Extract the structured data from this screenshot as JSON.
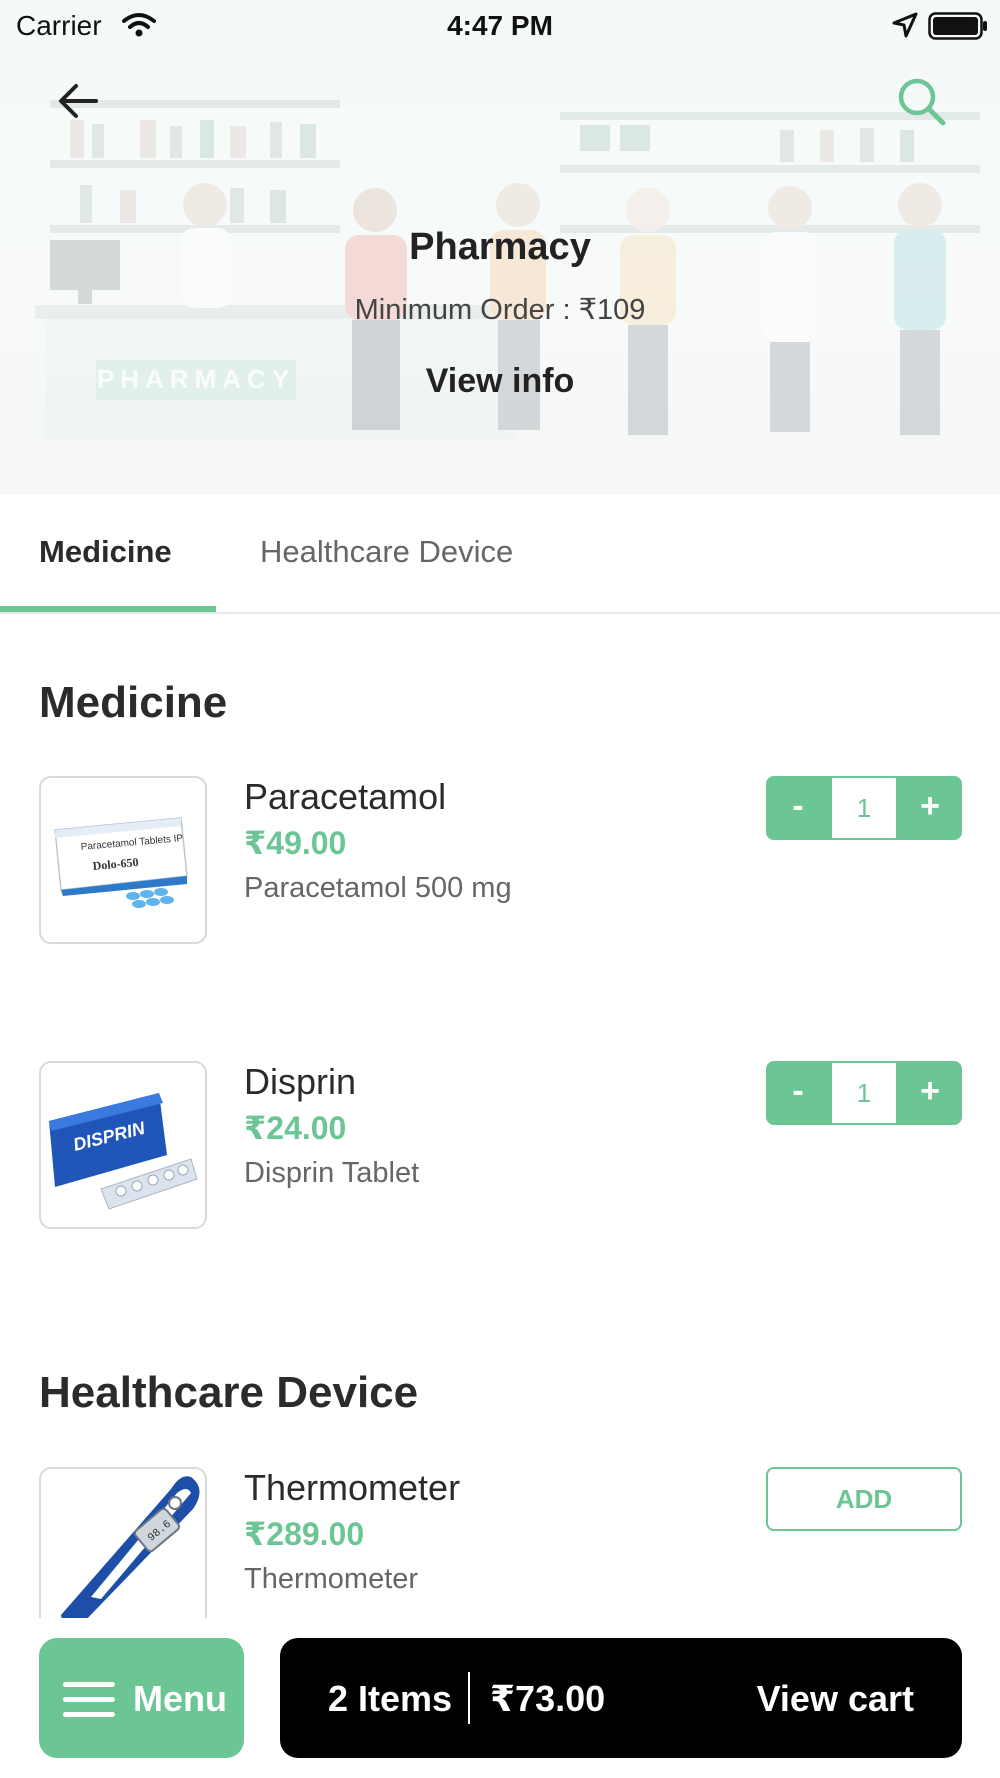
{
  "status_bar": {
    "carrier": "Carrier",
    "time": "4:47 PM"
  },
  "header": {
    "title": "Pharmacy",
    "minimum_order": "Minimum Order : ₹109",
    "view_info": "View info",
    "backdrop_sign": "PHARMACY"
  },
  "tabs": [
    {
      "label": "Medicine",
      "active": true
    },
    {
      "label": "Healthcare Device",
      "active": false
    }
  ],
  "sections": [
    {
      "heading": "Medicine",
      "products": [
        {
          "name": "Paracetamol",
          "price": "₹49.00",
          "description": "Paracetamol 500 mg",
          "quantity": "1",
          "image_icon": "paracetamol-box-image",
          "box_text": "Paracetamol Tablets IP",
          "box_brand": "Dolo-650"
        },
        {
          "name": "Disprin",
          "price": "₹24.00",
          "description": "Disprin Tablet",
          "quantity": "1",
          "image_icon": "disprin-box-image",
          "box_brand": "DISPRIN"
        }
      ]
    },
    {
      "heading": "Healthcare Device",
      "products": [
        {
          "name": "Thermometer",
          "price": "₹289.00",
          "description": "Thermometer",
          "add_label": "ADD",
          "image_icon": "thermometer-image",
          "display_reading": "98.6"
        }
      ]
    }
  ],
  "stepper": {
    "minus": "-",
    "plus": "+"
  },
  "bottom_bar": {
    "menu_label": "Menu",
    "cart_items": "2 Items",
    "cart_total": "₹73.00",
    "view_cart": "View cart"
  },
  "colors": {
    "accent": "#6cc594",
    "cart_bar": "#000000",
    "text": "#2b2b2b"
  }
}
